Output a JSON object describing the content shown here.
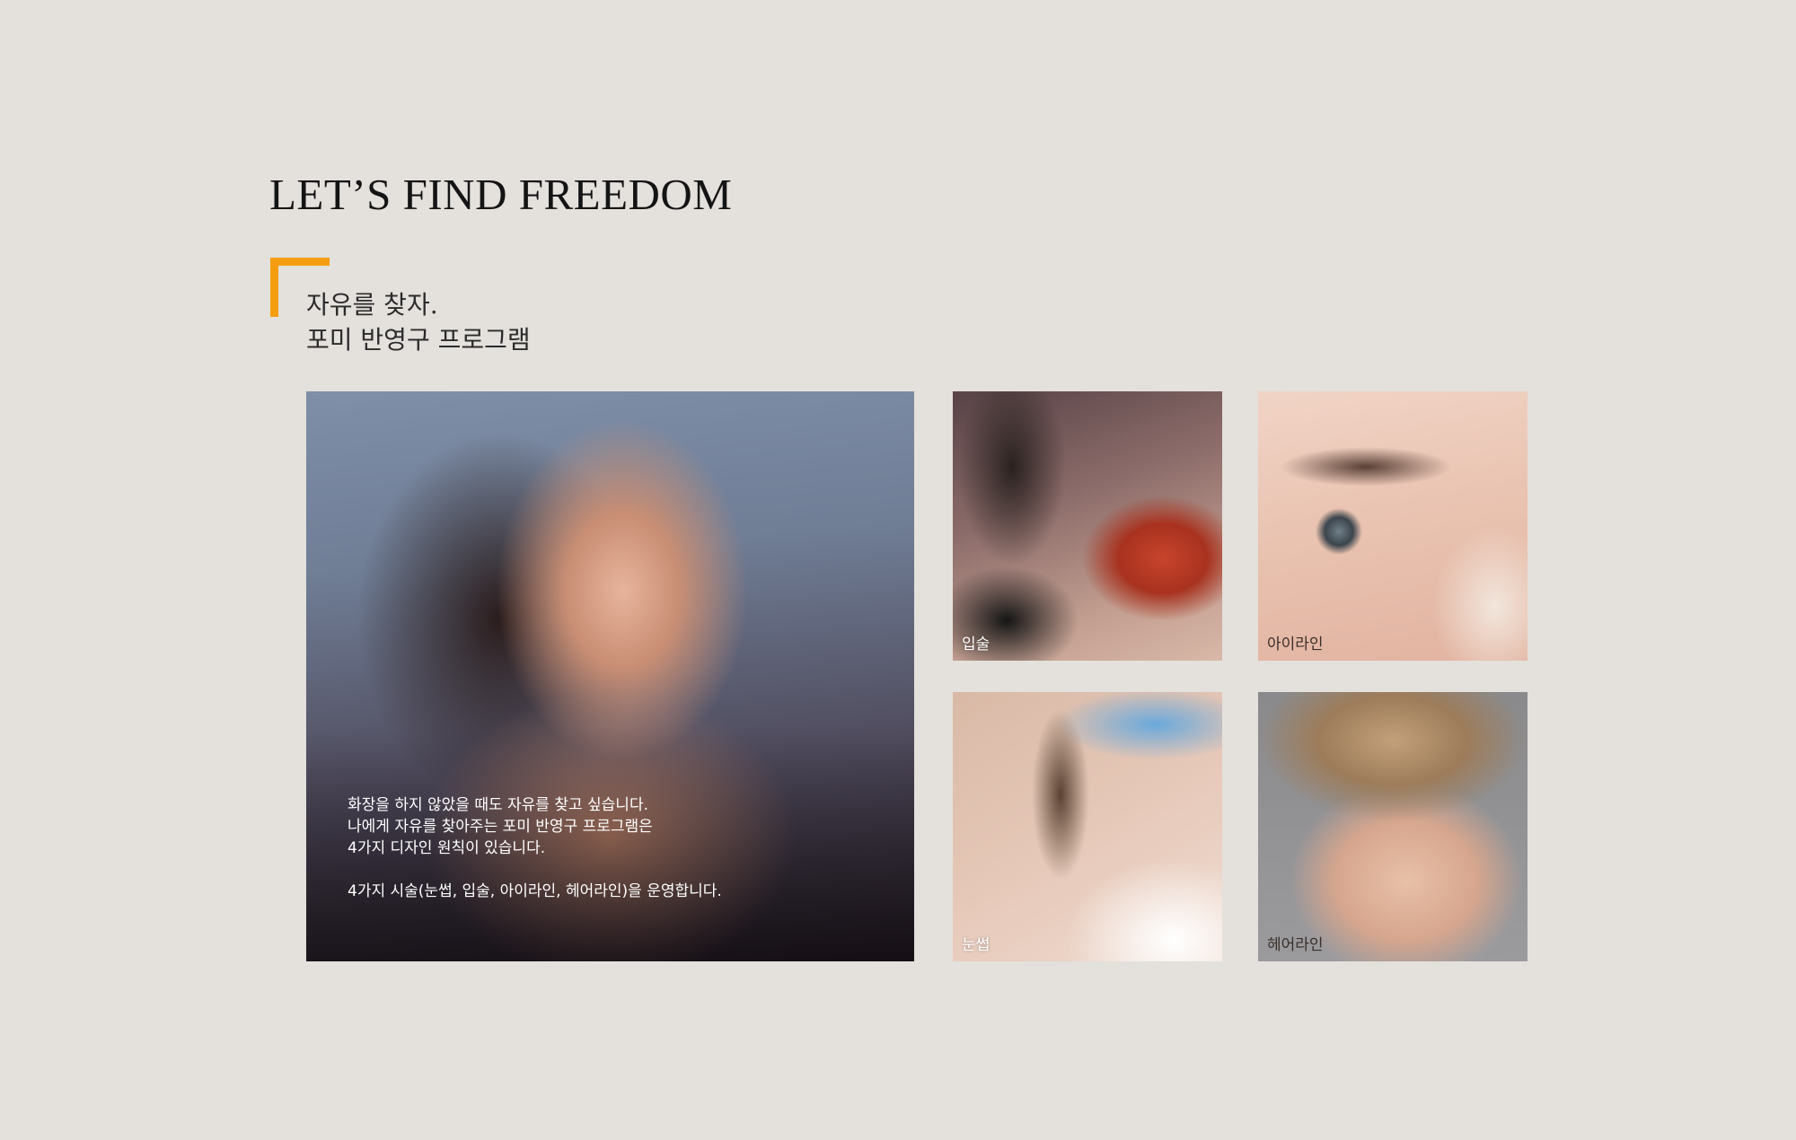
{
  "header": {
    "title": "LET’S FIND FREEDOM",
    "subtitle_line1": "자유를 찾자.",
    "subtitle_line2": "포미 반영구 프로그램"
  },
  "colors": {
    "accent": "#f59d10",
    "background": "#e4e0db"
  },
  "main_photo": {
    "text_lines": [
      "화장을 하지 않았을 때도 자유를 찾고 싶습니다.",
      "나에게 자유를 찾아주는 포미 반영구 프로그램은",
      "4가지 디자인 원칙이 있습니다."
    ],
    "text_note": "4가지 시술(눈썹, 입술, 아이라인, 헤어라인)을 운영합니다."
  },
  "gallery": [
    {
      "label": "입술"
    },
    {
      "label": "아이라인"
    },
    {
      "label": "눈썹"
    },
    {
      "label": "헤어라인"
    }
  ]
}
